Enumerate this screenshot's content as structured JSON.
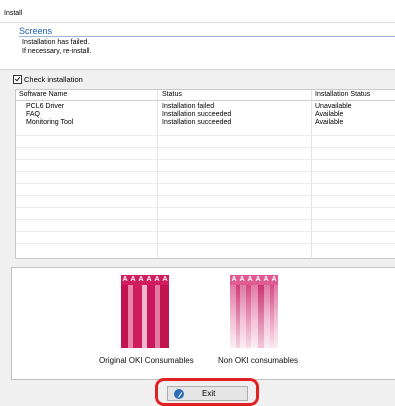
{
  "window": {
    "title": "Install"
  },
  "screens": {
    "heading": "Screens",
    "message_line1": "Installation has failed.",
    "message_line2": "If necessary, re-install."
  },
  "check_installation": {
    "label": "Check installation",
    "checked": true
  },
  "table": {
    "headers": [
      "Software Name",
      "Status",
      "Installation Status"
    ],
    "rows": [
      {
        "name": "PCL6 Driver",
        "status": "Installation failed",
        "install_status": "Unavailable"
      },
      {
        "name": "FAQ",
        "status": "Installation succeeded",
        "install_status": "Available"
      },
      {
        "name": "Monitoring Tool",
        "status": "Installation succeeded",
        "install_status": "Available"
      }
    ]
  },
  "consumables": {
    "original_caption": "Original OKI Consumables",
    "non_caption": "Non OKI consumables",
    "sample_letters": [
      "A",
      "A",
      "A",
      "A",
      "A",
      "A"
    ],
    "original_color": "#d11d5d",
    "non_color": "#d94a86"
  },
  "footer": {
    "exit_label": "Exit",
    "exit_icon": "exit-icon"
  }
}
